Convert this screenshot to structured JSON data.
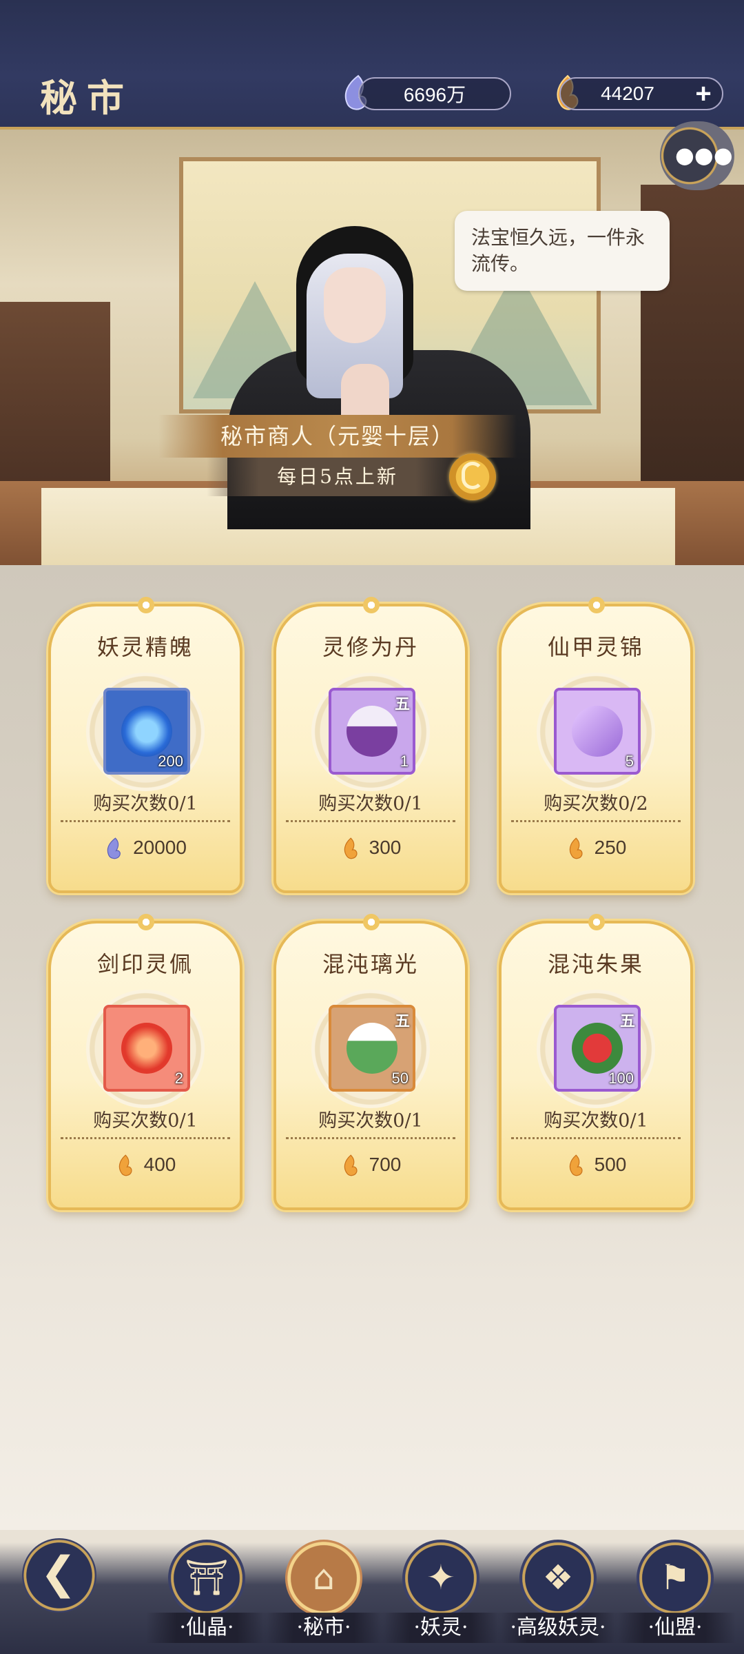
{
  "header": {
    "title": "秘市",
    "currencies": [
      {
        "icon": "spirit-jade-icon",
        "value": "6696万"
      },
      {
        "icon": "flame-crystal-icon",
        "value": "44207"
      }
    ],
    "add_label": "+"
  },
  "scene": {
    "speech": "法宝恒久远，一件永流传。",
    "merchant_name": "秘市商人（元婴十层）",
    "refresh_note": "每日5点上新",
    "chat_icon": "chat-bubble-icon",
    "refresh_icon": "refresh-icon"
  },
  "items": [
    {
      "name": "妖灵精魄",
      "qty": "200",
      "grade": "",
      "limit": "购买次数0/1",
      "price": "20000",
      "currency": "spirit-jade-icon",
      "frame": "#6f86c9"
    },
    {
      "name": "灵修为丹",
      "qty": "1",
      "grade": "五",
      "limit": "购买次数0/1",
      "price": "300",
      "currency": "flame-crystal-icon",
      "frame": "#9a5ad0"
    },
    {
      "name": "仙甲灵锦",
      "qty": "5",
      "grade": "",
      "limit": "购买次数0/2",
      "price": "250",
      "currency": "flame-crystal-icon",
      "frame": "#9a5ad0"
    },
    {
      "name": "剑印灵佩",
      "qty": "2",
      "grade": "",
      "limit": "购买次数0/1",
      "price": "400",
      "currency": "flame-crystal-icon",
      "frame": "#e35a4a"
    },
    {
      "name": "混沌璃光",
      "qty": "50",
      "grade": "五",
      "limit": "购买次数0/1",
      "price": "700",
      "currency": "flame-crystal-icon",
      "frame": "#d98a3a"
    },
    {
      "name": "混沌朱果",
      "qty": "100",
      "grade": "五",
      "limit": "购买次数0/1",
      "price": "500",
      "currency": "flame-crystal-icon",
      "frame": "#9a5ad0"
    }
  ],
  "nav": {
    "back_icon": "back-arrow-icon",
    "items": [
      {
        "label": "·仙晶·",
        "icon": "pavilion-icon",
        "active": false
      },
      {
        "label": "·秘市·",
        "icon": "market-stall-icon",
        "active": true
      },
      {
        "label": "·妖灵·",
        "icon": "fox-spirit-icon",
        "active": false
      },
      {
        "label": "·高级妖灵·",
        "icon": "dragon-spirit-icon",
        "active": false
      },
      {
        "label": "·仙盟·",
        "icon": "alliance-icon",
        "active": false
      }
    ]
  },
  "colors": {
    "accent_gold": "#c9a35a",
    "header_bg": "#2d3458",
    "card_border": "#e6b957"
  }
}
